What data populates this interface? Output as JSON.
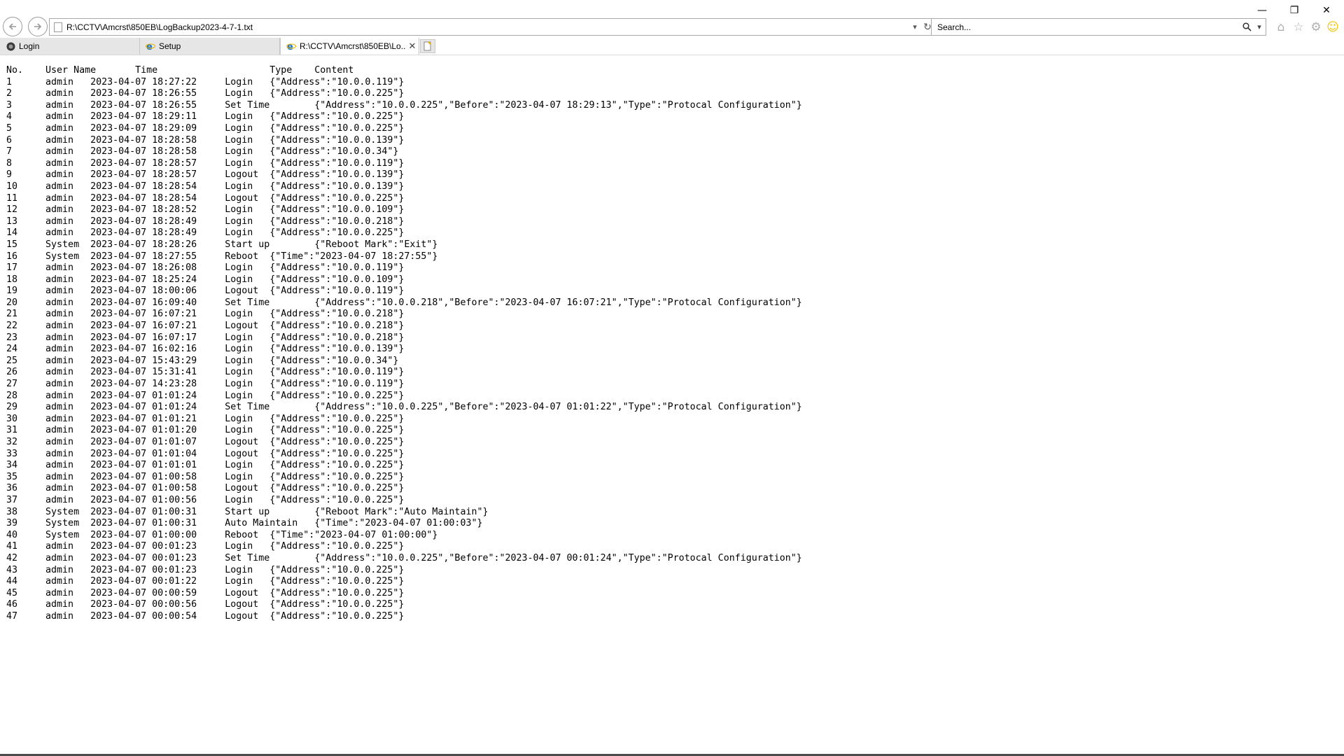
{
  "browser": {
    "address": "R:\\CCTV\\Amcrst\\850EB\\LogBackup2023-4-7-1.txt",
    "search_placeholder": "Search...",
    "tabs": [
      {
        "label": "Login",
        "icon": "globe-dark-icon"
      },
      {
        "label": "Setup",
        "icon": "ie-icon"
      },
      {
        "label": "R:\\CCTV\\Amcrst\\850EB\\Lo...",
        "icon": "ie-icon",
        "active": true
      }
    ],
    "accent": "#1e6fc0"
  },
  "log": {
    "header": "No.    User Name       Time                    Type    Content",
    "lines": [
      "1      admin   2023-04-07 18:27:22     Login   {\"Address\":\"10.0.0.119\"}",
      "2      admin   2023-04-07 18:26:55     Login   {\"Address\":\"10.0.0.225\"}",
      "3      admin   2023-04-07 18:26:55     Set Time        {\"Address\":\"10.0.0.225\",\"Before\":\"2023-04-07 18:29:13\",\"Type\":\"Protocal Configuration\"}",
      "4      admin   2023-04-07 18:29:11     Login   {\"Address\":\"10.0.0.225\"}",
      "5      admin   2023-04-07 18:29:09     Login   {\"Address\":\"10.0.0.225\"}",
      "6      admin   2023-04-07 18:28:58     Login   {\"Address\":\"10.0.0.139\"}",
      "7      admin   2023-04-07 18:28:58     Login   {\"Address\":\"10.0.0.34\"}",
      "8      admin   2023-04-07 18:28:57     Login   {\"Address\":\"10.0.0.119\"}",
      "9      admin   2023-04-07 18:28:57     Logout  {\"Address\":\"10.0.0.139\"}",
      "10     admin   2023-04-07 18:28:54     Login   {\"Address\":\"10.0.0.139\"}",
      "11     admin   2023-04-07 18:28:54     Logout  {\"Address\":\"10.0.0.225\"}",
      "12     admin   2023-04-07 18:28:52     Login   {\"Address\":\"10.0.0.109\"}",
      "13     admin   2023-04-07 18:28:49     Login   {\"Address\":\"10.0.0.218\"}",
      "14     admin   2023-04-07 18:28:49     Login   {\"Address\":\"10.0.0.225\"}",
      "15     System  2023-04-07 18:28:26     Start up        {\"Reboot Mark\":\"Exit\"}",
      "16     System  2023-04-07 18:27:55     Reboot  {\"Time\":\"2023-04-07 18:27:55\"}",
      "17     admin   2023-04-07 18:26:08     Login   {\"Address\":\"10.0.0.119\"}",
      "18     admin   2023-04-07 18:25:24     Login   {\"Address\":\"10.0.0.109\"}",
      "19     admin   2023-04-07 18:00:06     Logout  {\"Address\":\"10.0.0.119\"}",
      "20     admin   2023-04-07 16:09:40     Set Time        {\"Address\":\"10.0.0.218\",\"Before\":\"2023-04-07 16:07:21\",\"Type\":\"Protocal Configuration\"}",
      "21     admin   2023-04-07 16:07:21     Login   {\"Address\":\"10.0.0.218\"}",
      "22     admin   2023-04-07 16:07:21     Logout  {\"Address\":\"10.0.0.218\"}",
      "23     admin   2023-04-07 16:07:17     Login   {\"Address\":\"10.0.0.218\"}",
      "24     admin   2023-04-07 16:02:16     Login   {\"Address\":\"10.0.0.139\"}",
      "25     admin   2023-04-07 15:43:29     Login   {\"Address\":\"10.0.0.34\"}",
      "26     admin   2023-04-07 15:31:41     Login   {\"Address\":\"10.0.0.119\"}",
      "27     admin   2023-04-07 14:23:28     Login   {\"Address\":\"10.0.0.119\"}",
      "28     admin   2023-04-07 01:01:24     Login   {\"Address\":\"10.0.0.225\"}",
      "29     admin   2023-04-07 01:01:24     Set Time        {\"Address\":\"10.0.0.225\",\"Before\":\"2023-04-07 01:01:22\",\"Type\":\"Protocal Configuration\"}",
      "30     admin   2023-04-07 01:01:21     Login   {\"Address\":\"10.0.0.225\"}",
      "31     admin   2023-04-07 01:01:20     Login   {\"Address\":\"10.0.0.225\"}",
      "32     admin   2023-04-07 01:01:07     Logout  {\"Address\":\"10.0.0.225\"}",
      "33     admin   2023-04-07 01:01:04     Logout  {\"Address\":\"10.0.0.225\"}",
      "34     admin   2023-04-07 01:01:01     Login   {\"Address\":\"10.0.0.225\"}",
      "35     admin   2023-04-07 01:00:58     Login   {\"Address\":\"10.0.0.225\"}",
      "36     admin   2023-04-07 01:00:58     Logout  {\"Address\":\"10.0.0.225\"}",
      "37     admin   2023-04-07 01:00:56     Login   {\"Address\":\"10.0.0.225\"}",
      "38     System  2023-04-07 01:00:31     Start up        {\"Reboot Mark\":\"Auto Maintain\"}",
      "39     System  2023-04-07 01:00:31     Auto Maintain   {\"Time\":\"2023-04-07 01:00:03\"}",
      "40     System  2023-04-07 01:00:00     Reboot  {\"Time\":\"2023-04-07 01:00:00\"}",
      "41     admin   2023-04-07 00:01:23     Login   {\"Address\":\"10.0.0.225\"}",
      "42     admin   2023-04-07 00:01:23     Set Time        {\"Address\":\"10.0.0.225\",\"Before\":\"2023-04-07 00:01:24\",\"Type\":\"Protocal Configuration\"}",
      "43     admin   2023-04-07 00:01:23     Login   {\"Address\":\"10.0.0.225\"}",
      "44     admin   2023-04-07 00:01:22     Login   {\"Address\":\"10.0.0.225\"}",
      "45     admin   2023-04-07 00:00:59     Logout  {\"Address\":\"10.0.0.225\"}",
      "46     admin   2023-04-07 00:00:56     Logout  {\"Address\":\"10.0.0.225\"}",
      "47     admin   2023-04-07 00:00:54     Logout  {\"Address\":\"10.0.0.225\"}"
    ]
  }
}
